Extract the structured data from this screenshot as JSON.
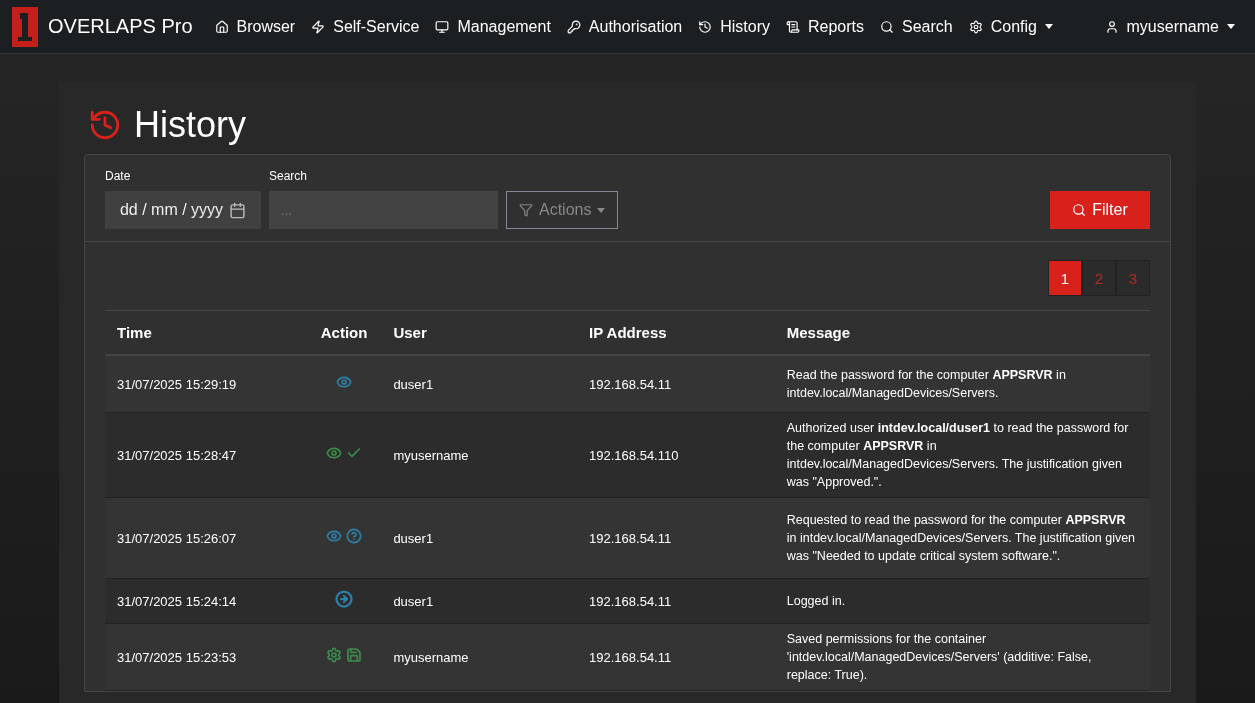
{
  "navbar": {
    "brand": "OVERLAPS Pro",
    "items": [
      {
        "label": "Browser",
        "dropdown": false
      },
      {
        "label": "Self-Service",
        "dropdown": false
      },
      {
        "label": "Management",
        "dropdown": false
      },
      {
        "label": "Authorisation",
        "dropdown": false
      },
      {
        "label": "History",
        "dropdown": false
      },
      {
        "label": "Reports",
        "dropdown": false
      },
      {
        "label": "Search",
        "dropdown": false
      },
      {
        "label": "Config",
        "dropdown": true
      }
    ],
    "user": {
      "label": "myusername",
      "dropdown": true
    }
  },
  "page_title": "History",
  "filters": {
    "date": {
      "label": "Date",
      "value": "dd / mm / yyyy"
    },
    "search": {
      "label": "Search",
      "placeholder": "..."
    },
    "actions_button": "Actions",
    "filter_button": "Filter"
  },
  "pagination": [
    {
      "label": "1",
      "selected": true
    },
    {
      "label": "2",
      "selected": false
    },
    {
      "label": "3",
      "selected": false
    }
  ],
  "table": {
    "columns": [
      "Time",
      "Action",
      "User",
      "IP Address",
      "Message"
    ],
    "rows": [
      {
        "time": "31/07/2025 15:29:19",
        "actions": [
          {
            "kind": "eye",
            "color": "#2e7fa8"
          }
        ],
        "user": "duser1",
        "ip": "192.168.54.11",
        "message": "Read the password for the computer **APPSRVR** in intdev.local/ManagedDevices/Servers."
      },
      {
        "time": "31/07/2025 15:28:47",
        "actions": [
          {
            "kind": "eye",
            "color": "#3c8a4a"
          },
          {
            "kind": "check",
            "color": "#3c8a4a"
          }
        ],
        "user": "myusername",
        "ip": "192.168.54.110",
        "message": "Authorized user **intdev.local/duser1** to read the password for the computer **APPSRVR** in intdev.local/ManagedDevices/Servers. The justification given was \"Approved.\"."
      },
      {
        "time": "31/07/2025 15:26:07",
        "actions": [
          {
            "kind": "eye",
            "color": "#2e7fa8"
          },
          {
            "kind": "question",
            "color": "#2e7fa8"
          }
        ],
        "user": "duser1",
        "ip": "192.168.54.11",
        "message": "Requested to read the password for the computer **APPSRVR** in intdev.local/ManagedDevices/Servers. The justification given was \"Needed to update critical system software.\"."
      },
      {
        "time": "31/07/2025 15:24:14",
        "actions": [
          {
            "kind": "login",
            "color": "#2e7fa8"
          }
        ],
        "user": "duser1",
        "ip": "192.168.54.11",
        "message": "Logged in."
      },
      {
        "time": "31/07/2025 15:23:53",
        "actions": [
          {
            "kind": "gear",
            "color": "#3c8a4a"
          },
          {
            "kind": "save",
            "color": "#3c8a4a"
          }
        ],
        "user": "myusername",
        "ip": "192.168.54.11",
        "message": "Saved permissions for the container 'intdev.local/ManagedDevices/Servers' (additive: False, replace: True)."
      }
    ]
  }
}
